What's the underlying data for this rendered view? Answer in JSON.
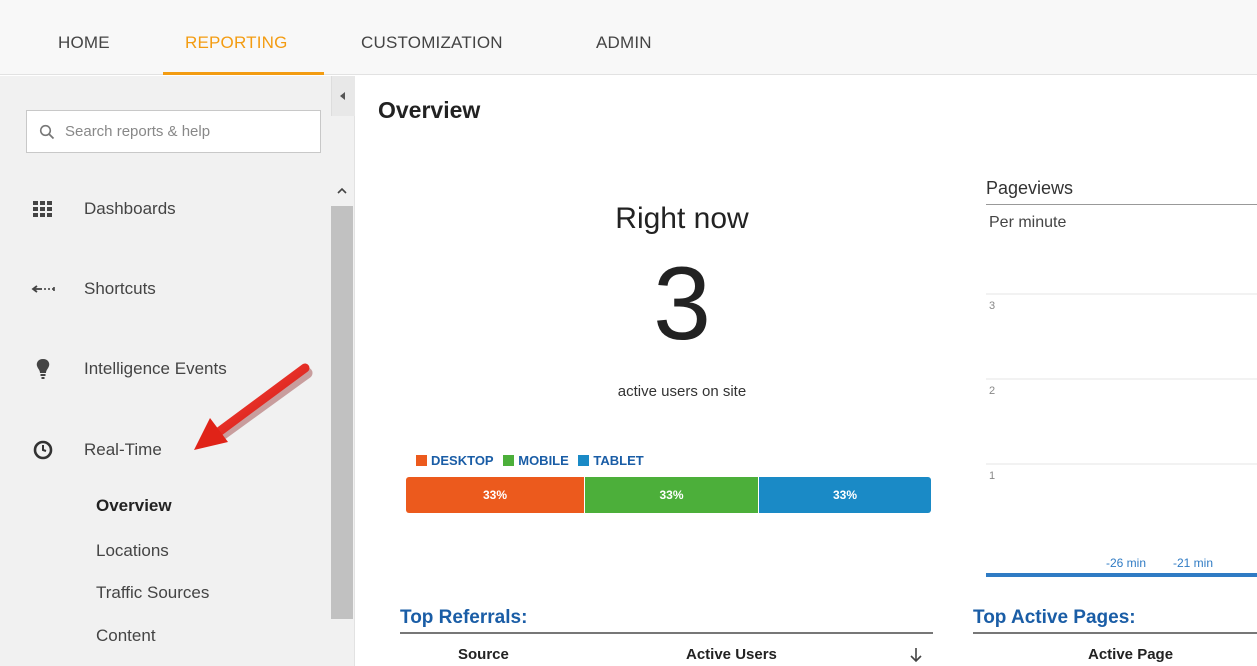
{
  "topnav": {
    "tabs": [
      {
        "label": "HOME"
      },
      {
        "label": "REPORTING"
      },
      {
        "label": "CUSTOMIZATION"
      },
      {
        "label": "ADMIN"
      }
    ]
  },
  "sidebar": {
    "search_placeholder": "Search reports & help",
    "items": [
      {
        "label": "Dashboards",
        "icon": "grid-icon"
      },
      {
        "label": "Shortcuts",
        "icon": "arrow-left-icon"
      },
      {
        "label": "Intelligence Events",
        "icon": "lightbulb-icon"
      },
      {
        "label": "Real-Time",
        "icon": "clock-icon"
      }
    ],
    "subitems": [
      {
        "label": "Overview"
      },
      {
        "label": "Locations"
      },
      {
        "label": "Traffic Sources"
      },
      {
        "label": "Content"
      }
    ]
  },
  "main": {
    "title": "Overview",
    "right_now_label": "Right now",
    "active_count": "3",
    "active_label": "active users on site",
    "devices": [
      {
        "label": "DESKTOP",
        "pct": "33%",
        "color": "#ec5a1d"
      },
      {
        "label": "MOBILE",
        "pct": "33%",
        "color": "#4caf3a"
      },
      {
        "label": "TABLET",
        "pct": "33%",
        "color": "#1a8ac6"
      }
    ],
    "pageviews": {
      "title": "Pageviews",
      "subtitle": "Per minute"
    },
    "top_referrals": {
      "title": "Top Referrals:",
      "col_source": "Source",
      "col_active_users": "Active Users",
      "sort_icon": "arrow-down-icon"
    },
    "top_active_pages": {
      "title": "Top Active Pages:",
      "col_active_page": "Active Page"
    }
  },
  "chart_data": {
    "type": "line",
    "title": "Pageviews",
    "subtitle": "Per minute",
    "y_ticks": [
      "3",
      "2",
      "1"
    ],
    "x_ticks": [
      "-26 min",
      "-21 min"
    ],
    "ylim": [
      0,
      3
    ],
    "grid": true
  },
  "colors": {
    "accent": "#f39c12",
    "link": "#1a5da6"
  }
}
